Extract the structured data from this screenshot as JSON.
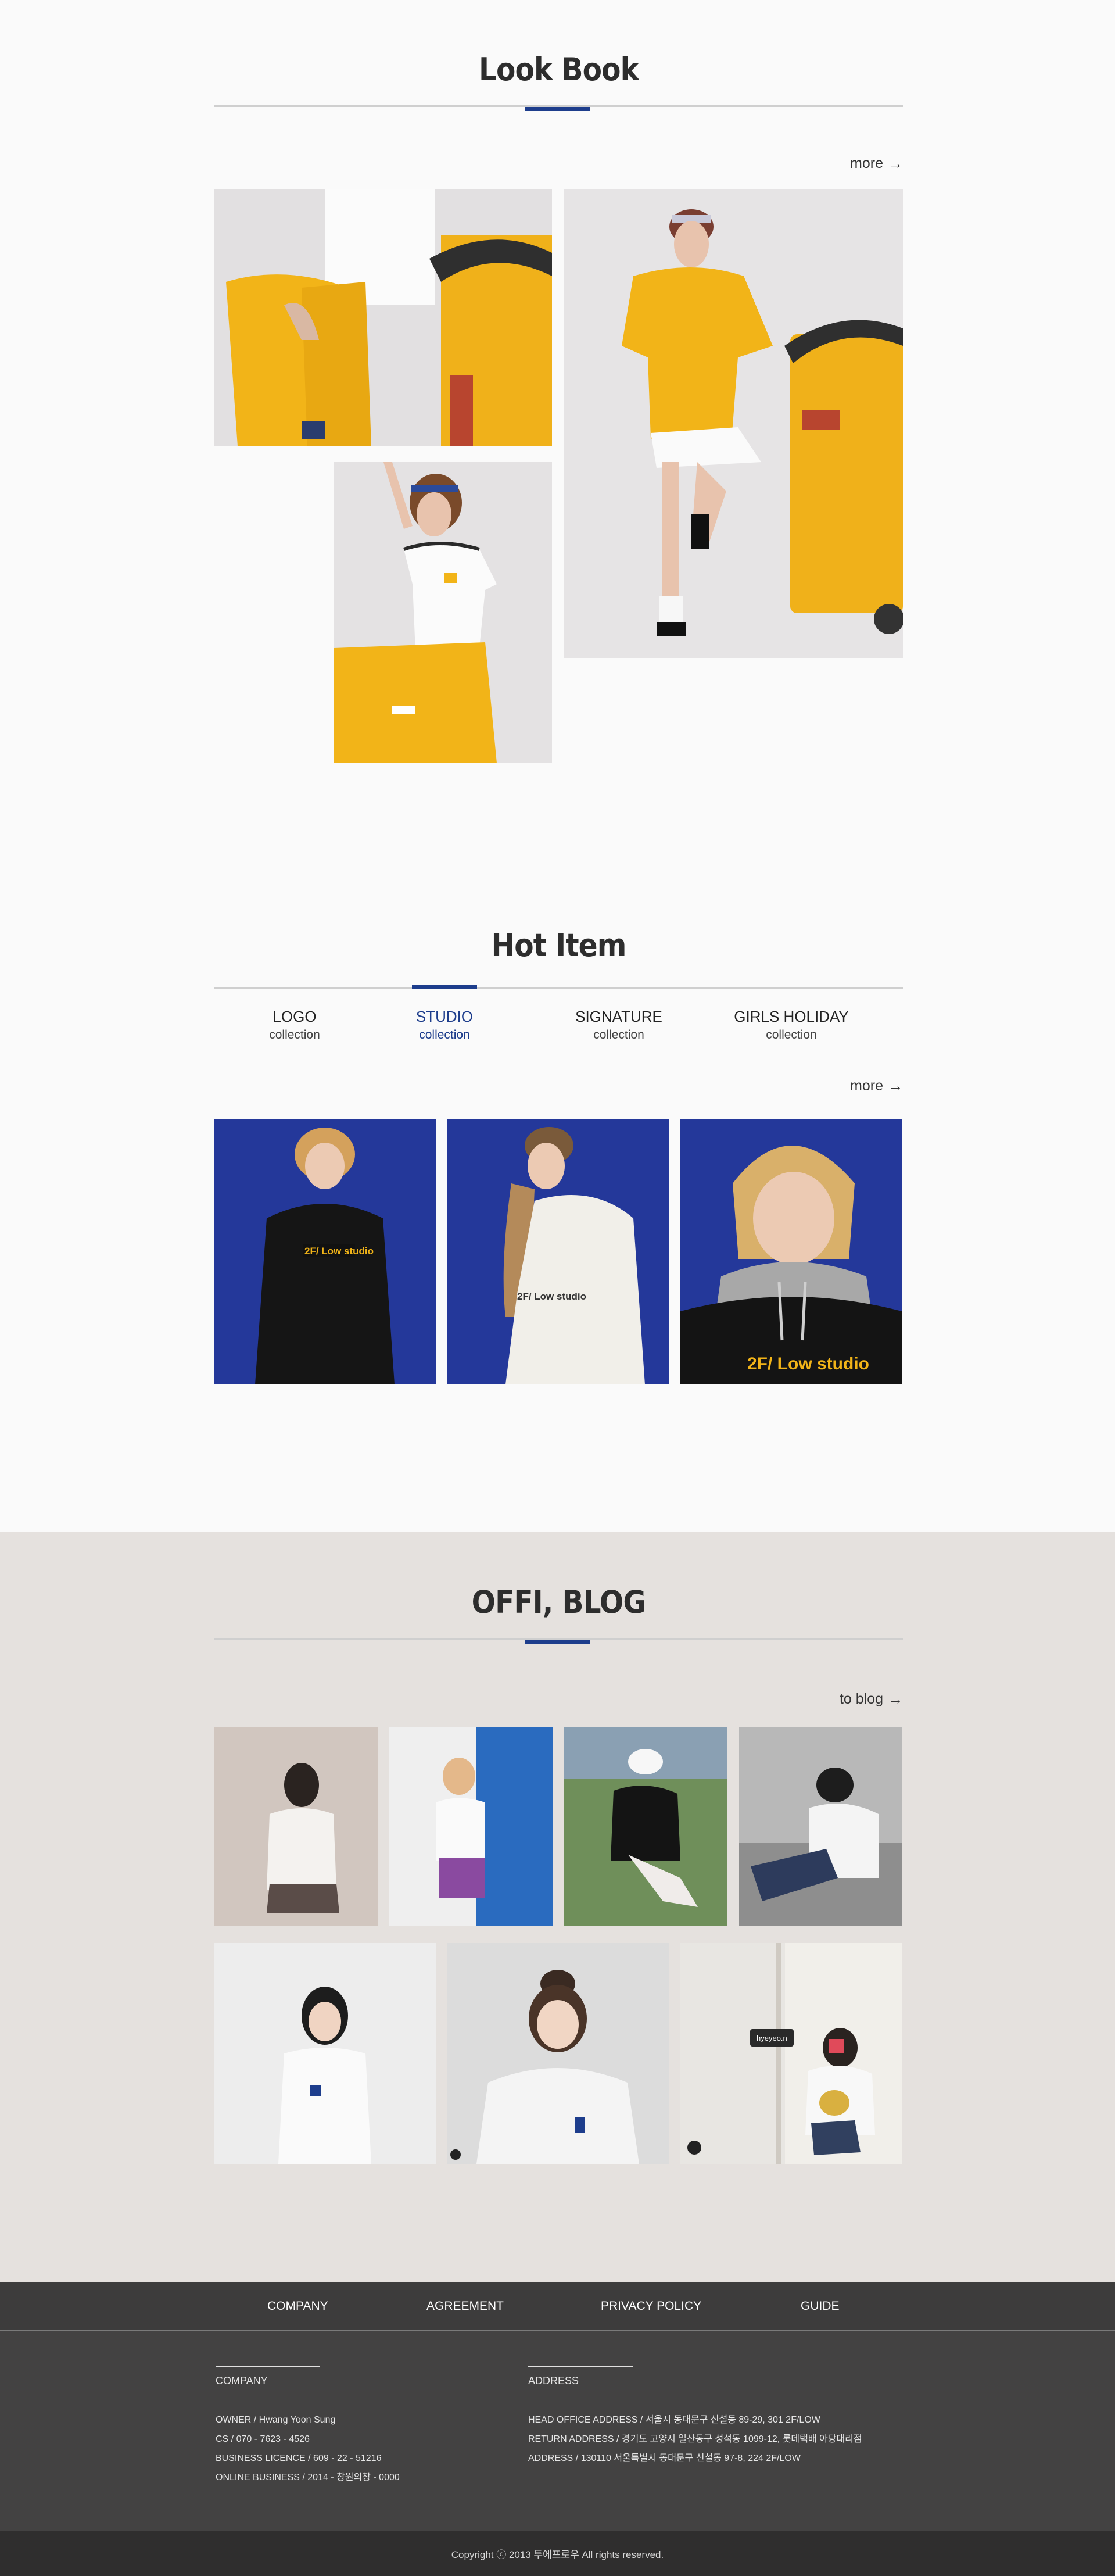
{
  "lookbook": {
    "title": "Look Book",
    "more_label": "more"
  },
  "hot_item": {
    "title": "Hot Item",
    "tabs": [
      {
        "name": "LOGO",
        "sub": "collection"
      },
      {
        "name": "STUDIO",
        "sub": "collection"
      },
      {
        "name": "SIGNATURE",
        "sub": "collection"
      },
      {
        "name": "GIRLS HOLIDAY",
        "sub": "collection"
      }
    ],
    "active_tab": "STUDIO",
    "more_label": "more",
    "product_print": "2F/ Low studio"
  },
  "blog": {
    "title": "OFFI, BLOG",
    "more_label": "to blog",
    "photo_tag": "hyeyeo.n"
  },
  "footer": {
    "nav": [
      "COMPANY",
      "AGREEMENT",
      "PRIVACY POLICY",
      "GUIDE"
    ],
    "company": {
      "heading": "COMPANY",
      "lines": [
        "OWNER  /  Hwang Yoon Sung",
        "CS  /  070 - 7623 - 4526",
        "BUSINESS LICENCE  /  609 - 22 - 51216",
        "ONLINE BUSINESS  /  2014 - 창원의창 - 0000"
      ]
    },
    "address": {
      "heading": "ADDRESS",
      "lines": [
        "HEAD OFFICE ADDRESS  /  서울시 동대문구 신설동 89-29, 301 2F/LOW",
        "RETURN ADDRESS  /  경기도 고양시 일산동구 성석동 1099-12, 롯데택배 아당대리점",
        "ADDRESS  /  130110 서울특별시 동대문구 신설동 97-8, 224  2F/LOW"
      ]
    },
    "copyright": "Copyright ⓒ 2013 투에프로우 All rights reserved."
  },
  "colors": {
    "accent": "#1d3d8c",
    "yellow": "#f2b418",
    "royal_blue": "#24389a",
    "blog_bg": "#e5e1de",
    "footer_bg": "#434242"
  }
}
